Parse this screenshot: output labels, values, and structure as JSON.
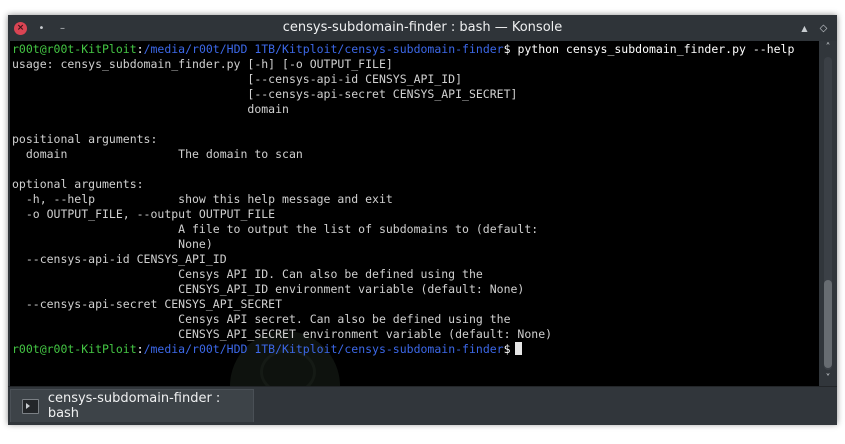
{
  "window": {
    "title": "censys-subdomain-finder : bash — Konsole",
    "buttons": {
      "close": "×",
      "pin": "•",
      "minimize": "–",
      "keep_above": "▲",
      "maximize": "◇"
    }
  },
  "prompt": {
    "user": "r00t@r00t-KitPloit",
    "separator": ":",
    "path": "/media/r00t/HDD 1TB/Kitploit/censys-subdomain-finder",
    "symbol": "$"
  },
  "command": " python censys_subdomain_finder.py --help",
  "output_lines": [
    "usage: censys_subdomain_finder.py [-h] [-o OUTPUT_FILE]",
    "                                  [--censys-api-id CENSYS_API_ID]",
    "                                  [--censys-api-secret CENSYS_API_SECRET]",
    "                                  domain",
    "",
    "positional arguments:",
    "  domain                The domain to scan",
    "",
    "optional arguments:",
    "  -h, --help            show this help message and exit",
    "  -o OUTPUT_FILE, --output OUTPUT_FILE",
    "                        A file to output the list of subdomains to (default:",
    "                        None)",
    "  --censys-api-id CENSYS_API_ID",
    "                        Censys API ID. Can also be defined using the",
    "                        CENSYS_API_ID environment variable (default: None)",
    "  --censys-api-secret CENSYS_API_SECRET",
    "                        Censys API secret. Can also be defined using the",
    "                        CENSYS_API_SECRET environment variable (default: None)"
  ],
  "scrollbar": {
    "up_arrow": "˄",
    "down_arrow": "˅"
  },
  "tabs": [
    {
      "label": "censys-subdomain-finder : bash",
      "icon": "terminal-icon",
      "active": true
    }
  ],
  "colors": {
    "prompt_user": "#44c644",
    "prompt_path": "#3c68e8",
    "terminal_bg": "#000000",
    "window_chrome": "#31363b",
    "close_button": "#da4453"
  }
}
